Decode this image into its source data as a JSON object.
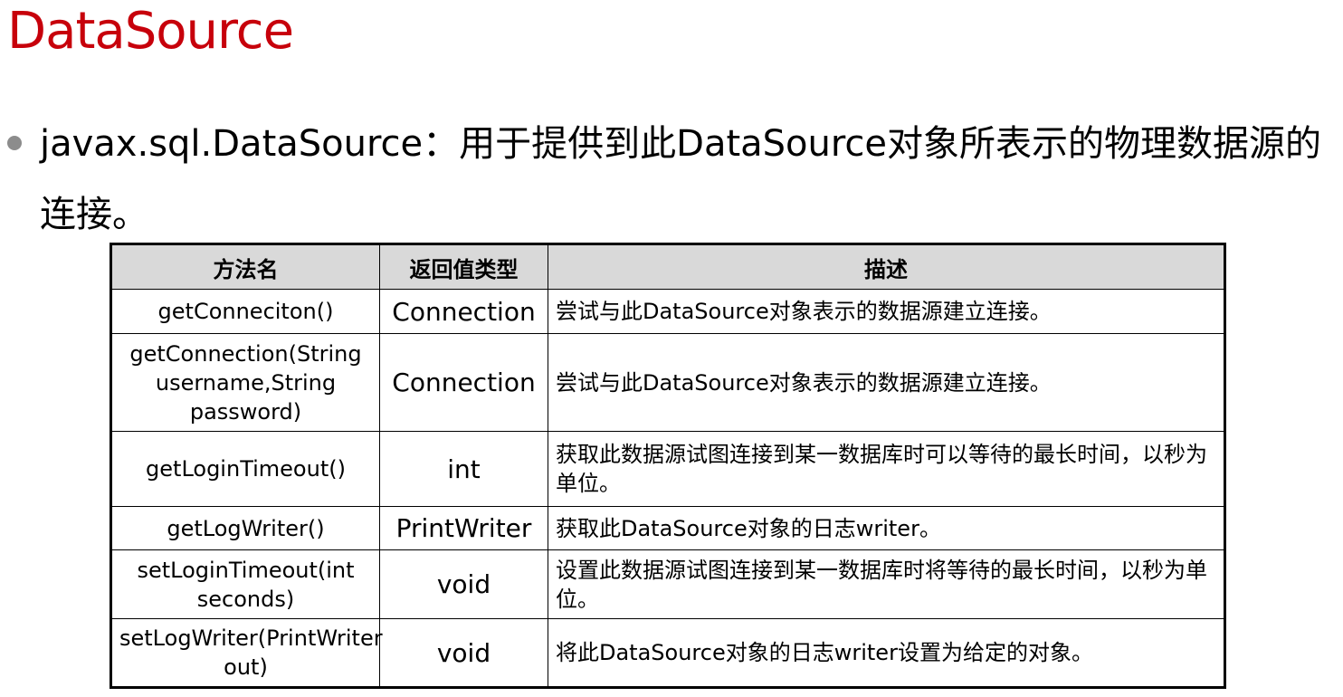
{
  "page": {
    "title": "DataSource",
    "bullet": "javax.sql.DataSource：用于提供到此DataSource对象所表示的物理数据源的连接。"
  },
  "table": {
    "headers": [
      "方法名",
      "返回值类型",
      "描述"
    ],
    "rows": [
      {
        "name": "getConneciton()",
        "type": "Connection",
        "desc": "尝试与此DataSource对象表示的数据源建立连接。"
      },
      {
        "name": "getConnection(String username,String password)",
        "type": "Connection",
        "desc": "尝试与此DataSource对象表示的数据源建立连接。"
      },
      {
        "name": "getLoginTimeout()",
        "type": "int",
        "desc": "获取此数据源试图连接到某一数据库时可以等待的最长时间，以秒为单位。"
      },
      {
        "name": "getLogWriter()",
        "type": "PrintWriter",
        "desc": "获取此DataSource对象的日志writer。"
      },
      {
        "name": "setLoginTimeout(int seconds)",
        "type": "void",
        "desc": "设置此数据源试图连接到某一数据库时将等待的最长时间，以秒为单位。"
      },
      {
        "name": "setLogWriter(PrintWriter out)",
        "type": "void",
        "desc": "将此DataSource对象的日志writer设置为给定的对象。"
      }
    ]
  },
  "colors": {
    "title": "#c7000b",
    "header_bg": "#d9d9d9",
    "bullet": "#8c8c8c"
  }
}
